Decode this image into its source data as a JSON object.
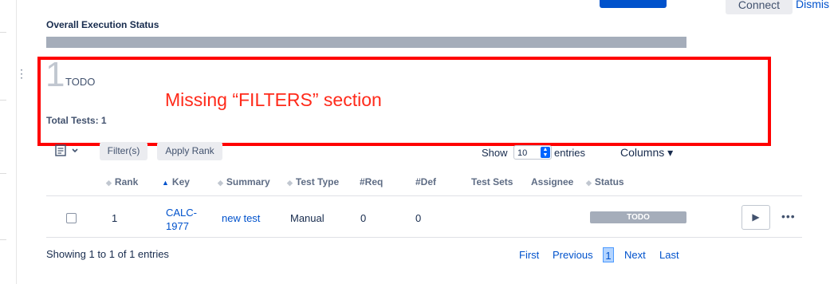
{
  "header": {
    "connect_label": "Connect",
    "dismiss_label": "Dismis"
  },
  "execution": {
    "title": "Overall Execution Status",
    "todo_count": "1",
    "todo_label": "TODO",
    "total_tests": "Total Tests: 1",
    "progress_todo_fraction": 1.0,
    "bar_color": "#a5adba"
  },
  "annotation": {
    "text": "Missing “FILTERS” section",
    "color": "#ff2a1a",
    "box_color": "#ff0000"
  },
  "toolbar": {
    "filters_label": "Filter(s)",
    "apply_rank_label": "Apply Rank",
    "show_label": "Show",
    "page_size": "10",
    "entries_label": "entries",
    "columns_label": "Columns ▾"
  },
  "table": {
    "headers": [
      "Rank",
      "Key",
      "Summary",
      "Test Type",
      "#Req",
      "#Def",
      "Test Sets",
      "Assignee",
      "Status"
    ],
    "rows": [
      {
        "rank": "1",
        "key_line1": "CALC-",
        "key_line2": "1977",
        "summary": "new test",
        "test_type": "Manual",
        "req": "0",
        "def": "0",
        "test_sets": "",
        "assignee": "",
        "status": "TODO"
      }
    ]
  },
  "footer": {
    "showing": "Showing 1 to 1 of 1 entries",
    "first": "First",
    "previous": "Previous",
    "current": "1",
    "next": "Next",
    "last": "Last"
  },
  "colors": {
    "accent": "#0052cc",
    "status_todo": "#a5adba"
  }
}
